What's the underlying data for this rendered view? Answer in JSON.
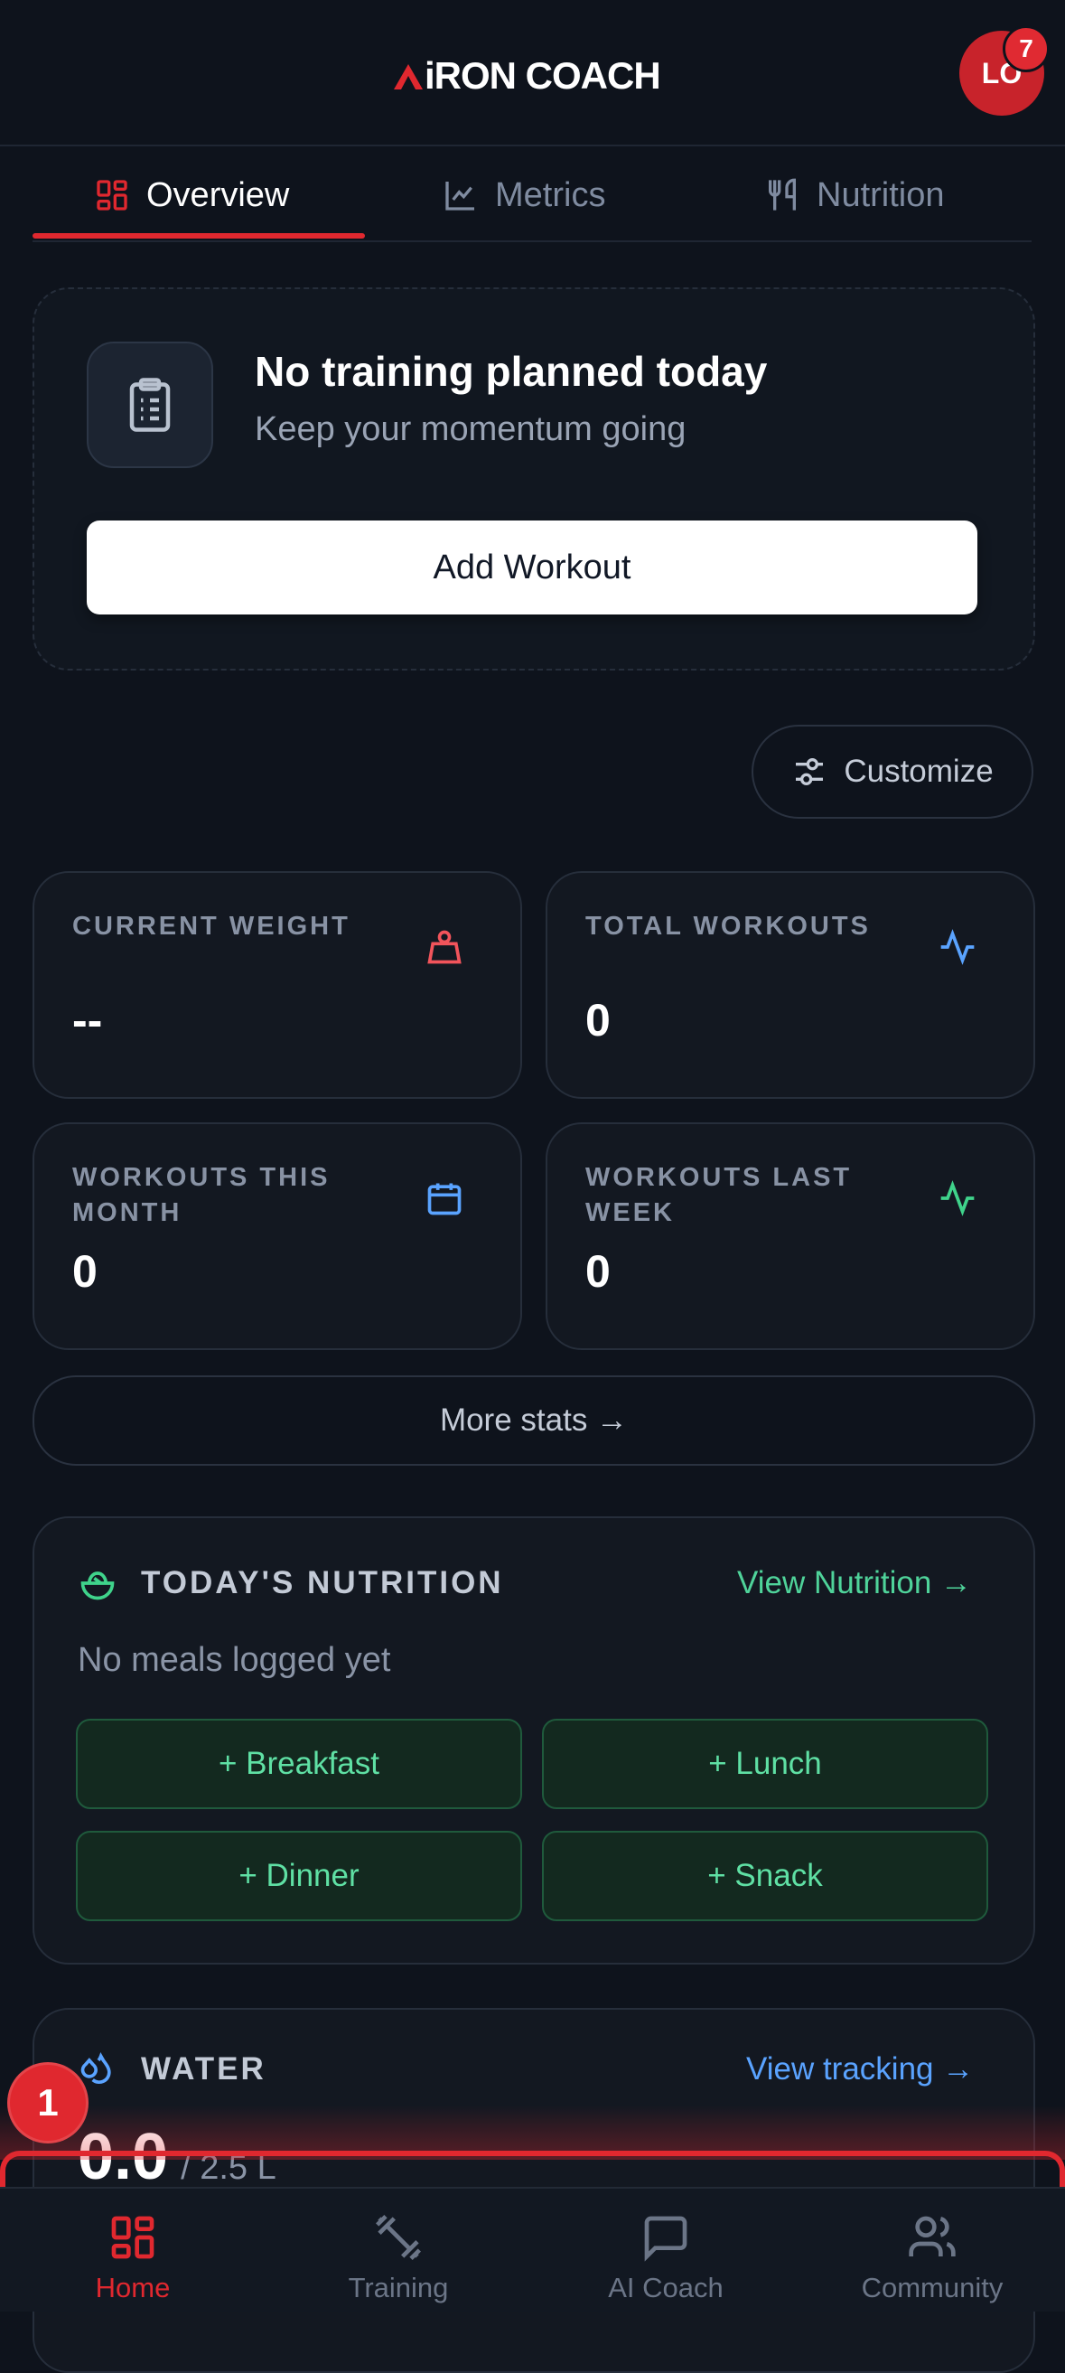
{
  "header": {
    "logo_text": "iRON COACH",
    "avatar_initials": "LO",
    "notification_count": "7"
  },
  "tabs": [
    {
      "label": "Overview",
      "icon": "grid-icon",
      "active": true
    },
    {
      "label": "Metrics",
      "icon": "line-chart-icon",
      "active": false
    },
    {
      "label": "Nutrition",
      "icon": "utensils-icon",
      "active": false
    }
  ],
  "training_card": {
    "title": "No training planned today",
    "subtitle": "Keep your momentum going",
    "button": "Add Workout"
  },
  "customize_label": "Customize",
  "stats": [
    {
      "label": "CURRENT WEIGHT",
      "value": "--",
      "icon": "weight-icon",
      "color": "#f2545b"
    },
    {
      "label": "TOTAL WORKOUTS",
      "value": "0",
      "icon": "activity-icon",
      "color": "#5aa3ff"
    },
    {
      "label": "WORKOUTS THIS MONTH",
      "value": "0",
      "icon": "calendar-icon",
      "color": "#5aa3ff"
    },
    {
      "label": "WORKOUTS LAST WEEK",
      "value": "0",
      "icon": "activity-icon",
      "color": "#3fd38b"
    }
  ],
  "more_stats": "More stats →",
  "nutrition": {
    "title": "TODAY'S NUTRITION",
    "link": "View Nutrition →",
    "empty": "No meals logged yet",
    "meals": [
      "+ Breakfast",
      "+ Lunch",
      "+ Dinner",
      "+ Snack"
    ]
  },
  "water": {
    "title": "WATER",
    "link": "View tracking →",
    "amount": "0.0",
    "target": "/ 2.5 L"
  },
  "bottom_nav": [
    {
      "label": "Home",
      "icon": "home-grid-icon",
      "active": true
    },
    {
      "label": "Training",
      "icon": "dumbbell-icon",
      "active": false
    },
    {
      "label": "AI Coach",
      "icon": "chat-icon",
      "active": false
    },
    {
      "label": "Community",
      "icon": "users-icon",
      "active": false
    }
  ],
  "annotation_number": "1",
  "colors": {
    "background": "#0e131c",
    "accent_red": "#e0282f",
    "accent_green": "#5fe0a4",
    "accent_blue": "#5aa3ff"
  }
}
